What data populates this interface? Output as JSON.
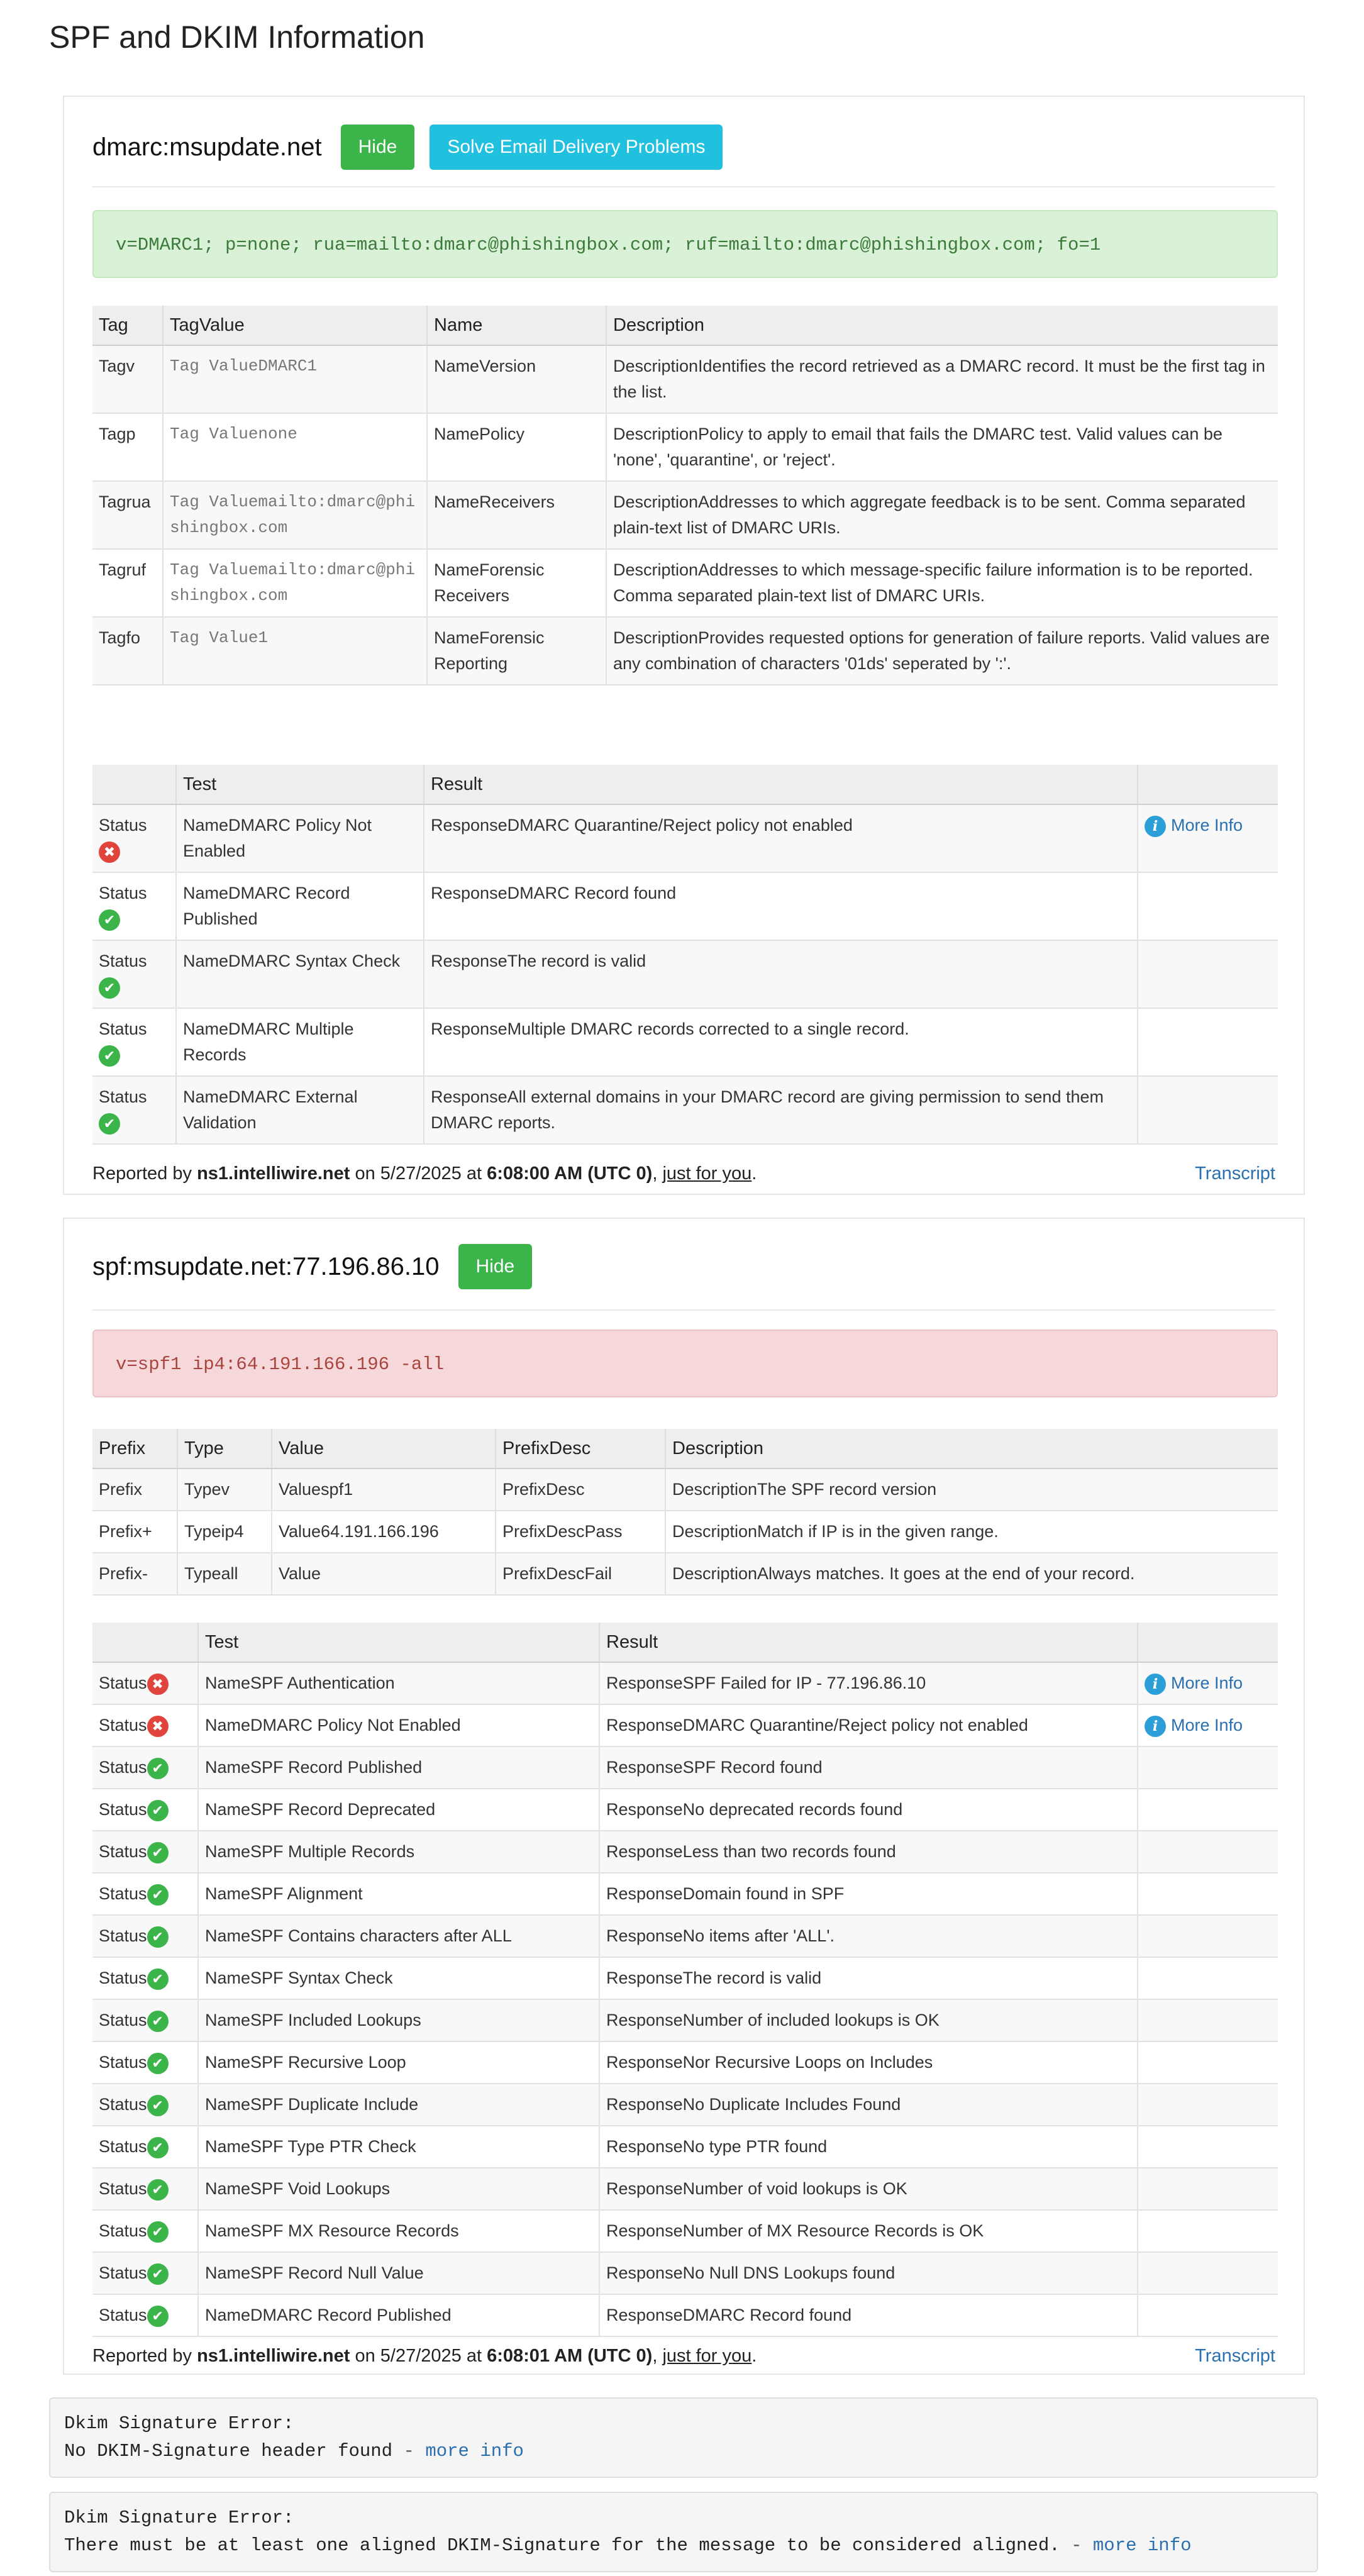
{
  "page": {
    "title": "SPF and DKIM Information"
  },
  "dmarc": {
    "record_name": "dmarc:msupdate.net",
    "hide_label": "Hide",
    "solve_label": "Solve Email Delivery Problems",
    "record_text": "v=DMARC1; p=none; rua=mailto:dmarc@phishingbox.com; ruf=mailto:dmarc@phishingbox.com; fo=1",
    "tag_headers": [
      "Tag",
      "TagValue",
      "Name",
      "Description"
    ],
    "tags": [
      {
        "tag": "Tagv",
        "value": "Tag ValueDMARC1",
        "name": "NameVersion",
        "desc": "DescriptionIdentifies the record retrieved as a DMARC record. It must be the first tag in the list."
      },
      {
        "tag": "Tagp",
        "value": "Tag Valuenone",
        "name": "NamePolicy",
        "desc": "DescriptionPolicy to apply to email that fails the DMARC test. Valid values can be 'none', 'quarantine', or 'reject'."
      },
      {
        "tag": "Tagrua",
        "value": "Tag Valuemailto:dmarc@phishingbox.com",
        "name": "NameReceivers",
        "desc": "DescriptionAddresses to which aggregate feedback is to be sent. Comma separated plain-text list of DMARC URIs."
      },
      {
        "tag": "Tagruf",
        "value": "Tag Valuemailto:dmarc@phishingbox.com",
        "name": "NameForensic Receivers",
        "desc": "DescriptionAddresses to which message-specific failure information is to be reported. Comma separated plain-text list of DMARC URIs."
      },
      {
        "tag": "Tagfo",
        "value": "Tag Value1",
        "name": "NameForensic Reporting",
        "desc": "DescriptionProvides requested options for generation of failure reports. Valid values are any combination of characters '01ds' seperated by ':'."
      }
    ],
    "test_headers": [
      "",
      "Test",
      "Result",
      ""
    ],
    "tests": [
      {
        "status": "Status",
        "ok": false,
        "name": "NameDMARC Policy Not Enabled",
        "result": "ResponseDMARC Quarantine/Reject policy not enabled",
        "more": "More Info"
      },
      {
        "status": "Status",
        "ok": true,
        "name": "NameDMARC Record Published",
        "result": "ResponseDMARC Record found",
        "more": ""
      },
      {
        "status": "Status",
        "ok": true,
        "name": "NameDMARC Syntax Check",
        "result": "ResponseThe record is valid",
        "more": ""
      },
      {
        "status": "Status",
        "ok": true,
        "name": "NameDMARC Multiple Records",
        "result": "ResponseMultiple DMARC records corrected to a single record.",
        "more": ""
      },
      {
        "status": "Status",
        "ok": true,
        "name": "NameDMARC External Validation",
        "result": "ResponseAll external domains in your DMARC record are giving permission to send them DMARC reports.",
        "more": ""
      }
    ],
    "footer": {
      "reported_by": "Reported by",
      "server": "ns1.intelliwire.net",
      "on": "on 5/27/2025 at",
      "time": "6:08:00 AM (UTC 0)",
      "comma": ",",
      "just": "just for you",
      "period": ".",
      "transcript": "Transcript"
    }
  },
  "spf": {
    "record_name": "spf:msupdate.net:77.196.86.10",
    "hide_label": "Hide",
    "record_text": "v=spf1 ip4:64.191.166.196 -all",
    "prefix_headers": [
      "Prefix",
      "Type",
      "Value",
      "PrefixDesc",
      "Description"
    ],
    "prefixes": [
      {
        "prefix": "Prefix",
        "type": "Typev",
        "value": "Valuespf1",
        "pdesc": "PrefixDesc",
        "desc": "DescriptionThe SPF record version"
      },
      {
        "prefix": "Prefix+",
        "type": "Typeip4",
        "value": "Value64.191.166.196",
        "pdesc": "PrefixDescPass",
        "desc": "DescriptionMatch if IP is in the given range."
      },
      {
        "prefix": "Prefix-",
        "type": "Typeall",
        "value": "Value",
        "pdesc": "PrefixDescFail",
        "desc": "DescriptionAlways matches. It goes at the end of your record."
      }
    ],
    "test_headers": [
      "",
      "Test",
      "Result",
      ""
    ],
    "tests": [
      {
        "status": "Status",
        "ok": false,
        "name": "NameSPF Authentication",
        "result": "ResponseSPF Failed for IP - 77.196.86.10",
        "more": "More Info"
      },
      {
        "status": "Status",
        "ok": false,
        "name": "NameDMARC Policy Not Enabled",
        "result": "ResponseDMARC Quarantine/Reject policy not enabled",
        "more": "More Info"
      },
      {
        "status": "Status",
        "ok": true,
        "name": "NameSPF Record Published",
        "result": "ResponseSPF Record found",
        "more": ""
      },
      {
        "status": "Status",
        "ok": true,
        "name": "NameSPF Record Deprecated",
        "result": "ResponseNo deprecated records found",
        "more": ""
      },
      {
        "status": "Status",
        "ok": true,
        "name": "NameSPF Multiple Records",
        "result": "ResponseLess than two records found",
        "more": ""
      },
      {
        "status": "Status",
        "ok": true,
        "name": "NameSPF Alignment",
        "result": "ResponseDomain found in SPF",
        "more": ""
      },
      {
        "status": "Status",
        "ok": true,
        "name": "NameSPF Contains characters after ALL",
        "result": "ResponseNo items after 'ALL'.",
        "more": ""
      },
      {
        "status": "Status",
        "ok": true,
        "name": "NameSPF Syntax Check",
        "result": "ResponseThe record is valid",
        "more": ""
      },
      {
        "status": "Status",
        "ok": true,
        "name": "NameSPF Included Lookups",
        "result": "ResponseNumber of included lookups is OK",
        "more": ""
      },
      {
        "status": "Status",
        "ok": true,
        "name": "NameSPF Recursive Loop",
        "result": "ResponseNor Recursive Loops on Includes",
        "more": ""
      },
      {
        "status": "Status",
        "ok": true,
        "name": "NameSPF Duplicate Include",
        "result": "ResponseNo Duplicate Includes Found",
        "more": ""
      },
      {
        "status": "Status",
        "ok": true,
        "name": "NameSPF Type PTR Check",
        "result": "ResponseNo type PTR found",
        "more": ""
      },
      {
        "status": "Status",
        "ok": true,
        "name": "NameSPF Void Lookups",
        "result": "ResponseNumber of void lookups is OK",
        "more": ""
      },
      {
        "status": "Status",
        "ok": true,
        "name": "NameSPF MX Resource Records",
        "result": "ResponseNumber of MX Resource Records is OK",
        "more": ""
      },
      {
        "status": "Status",
        "ok": true,
        "name": "NameSPF Record Null Value",
        "result": "ResponseNo Null DNS Lookups found",
        "more": ""
      },
      {
        "status": "Status",
        "ok": true,
        "name": "NameDMARC Record Published",
        "result": "ResponseDMARC Record found",
        "more": ""
      }
    ],
    "footer": {
      "reported_by": "Reported by",
      "server": "ns1.intelliwire.net",
      "on": "on 5/27/2025 at",
      "time": "6:08:01 AM (UTC 0)",
      "comma": ",",
      "just": "just for you",
      "period": ".",
      "transcript": "Transcript"
    }
  },
  "dkim": [
    {
      "heading": "Dkim Signature Error:",
      "message": "No DKIM-Signature header found",
      "dash": " - ",
      "link": "more info"
    },
    {
      "heading": "Dkim Signature Error:",
      "message": "There must be at least one aligned DKIM-Signature for the message to be considered aligned.",
      "dash": " - ",
      "link": "more info"
    }
  ],
  "colors": {
    "ok": "#3bb44a",
    "error": "#e0443c",
    "info": "#2d9fd8",
    "link": "#2a6fb0",
    "button_green": "#3bb44a",
    "button_cyan": "#21c0de"
  },
  "icons": {
    "ok": "check-circle-icon",
    "error": "x-circle-icon",
    "info": "info-circle-icon"
  }
}
